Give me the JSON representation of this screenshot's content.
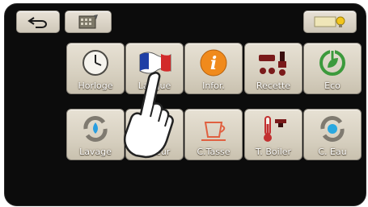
{
  "header": {
    "back_icon": "undo-arrow-icon",
    "calendar_icon": "calendar-icon",
    "light_icon": "lightbulb-icon"
  },
  "menu": {
    "row1": [
      {
        "label": "Horloge",
        "icon": "clock-icon"
      },
      {
        "label": "Langue",
        "icon": "flag-icon"
      },
      {
        "label": "Infor.",
        "icon": "info-icon"
      },
      {
        "label": "Recette",
        "icon": "recipe-cup-icon"
      },
      {
        "label": "Eco",
        "icon": "eco-power-icon"
      }
    ],
    "row2": [
      {
        "label": "Lavage",
        "icon": "wash-cycle-icon"
      },
      {
        "label": "Vapeur",
        "icon": "steam-cup-icon"
      },
      {
        "label": "C.Tasse",
        "icon": "cup-warmer-icon"
      },
      {
        "label": "T. Boiler",
        "icon": "thermometer-icon"
      },
      {
        "label": "C. Eau",
        "icon": "water-cycle-icon"
      }
    ]
  },
  "colors": {
    "screen_bg": "#0c0c0c",
    "tile_bg": "#d7d0c0",
    "info_orange": "#f08a1c",
    "eco_green": "#3c9a3c",
    "recipe_red": "#7a1a1a"
  }
}
